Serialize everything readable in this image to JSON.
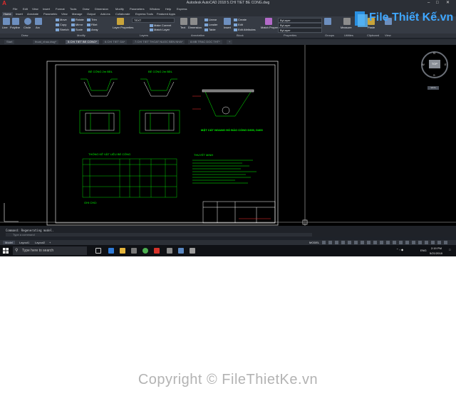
{
  "window": {
    "title": "Autodesk AutoCAD 2018   5.CHI TIET BE CONG.dwg",
    "app_icon": "A"
  },
  "menu": {
    "items": [
      "File",
      "Edit",
      "View",
      "Insert",
      "Format",
      "Tools",
      "Draw",
      "Dimension",
      "Modify",
      "Parameters",
      "Window",
      "Help",
      "Express"
    ]
  },
  "ribbon": {
    "tabs": [
      "Home",
      "Insert",
      "Annotate",
      "Parametric",
      "View",
      "Manage",
      "Output",
      "Add-ins",
      "Collaborate",
      "Express Tools",
      "Featured Apps"
    ],
    "draw_tools": [
      "Line",
      "Polyline",
      "Circle",
      "Arc"
    ],
    "modify_tools": [
      "Move",
      "Rotate",
      "Trim",
      "Copy",
      "Mirror",
      "Fillet",
      "Stretch",
      "Scale",
      "Array"
    ],
    "layer_tools": [
      "Layer Properties",
      "Make Current",
      "Match Layer"
    ],
    "annotation_tools": [
      "Text",
      "Dimension",
      "Linear",
      "Leader",
      "Table"
    ],
    "block_tools": [
      "Insert",
      "Create",
      "Edit",
      "Edit Attributes"
    ],
    "properties_tools": [
      "Match Properties"
    ],
    "utilities_tools": [
      "Measure"
    ],
    "clipboard_tools": [
      "Paste"
    ],
    "layer_dropdown": "TEXT",
    "bylayer": [
      "ByLayer",
      "ByLayer",
      "ByLayer"
    ],
    "panel_labels": [
      "Draw",
      "Modify",
      "Layers",
      "Annotation",
      "Block",
      "Properties",
      "Groups",
      "Utilities",
      "Clipboard",
      "View"
    ]
  },
  "document_tabs": {
    "items": [
      "Start",
      "thoat_nhau.dwg*",
      "5.CHI TIET BE CONG*",
      "6.CHI TIET GA*",
      "7.CHI TIET THOAT NUOC BEN NHA*",
      "8.MB TRAC DOC THT*"
    ],
    "active_index": 2
  },
  "viewcube": {
    "label": "TOP",
    "n": "N",
    "s": "S",
    "e": "E",
    "w": "W",
    "wcs": "WCS"
  },
  "drawing": {
    "title_left": "BỂ CỐNG 2m BĐL",
    "title_right": "BỂ CỐNG 2m BĐL",
    "section_label": "MẶT CẮT NGANG HỐ ĐÀO CỐNG D300, D400",
    "table_title": "THỐNG KÊ VẬT LIỆU BỂ CỐNG",
    "notes_title": "THUYẾT MINH",
    "ghi_chu": "GHI CHÚ:"
  },
  "command": {
    "history": "Command: Regenerating model.",
    "placeholder": "Type a command"
  },
  "status": {
    "layout_tabs": [
      "Model",
      "Layout1",
      "Layout2"
    ],
    "mode": "MODEL"
  },
  "taskbar": {
    "search_placeholder": "Type here to search",
    "time": "2:19 PM",
    "date": "5/21/2018",
    "lang": "ENG"
  },
  "logo": {
    "text": "File Thiết Kế.vn"
  },
  "watermark": {
    "text": "Copyright © FileThietKe.vn"
  },
  "colors": {
    "accent": "#3fa7ff",
    "drawing_green": "#00ff00",
    "drawing_white": "#ffffff",
    "drawing_red": "#ff3030"
  }
}
